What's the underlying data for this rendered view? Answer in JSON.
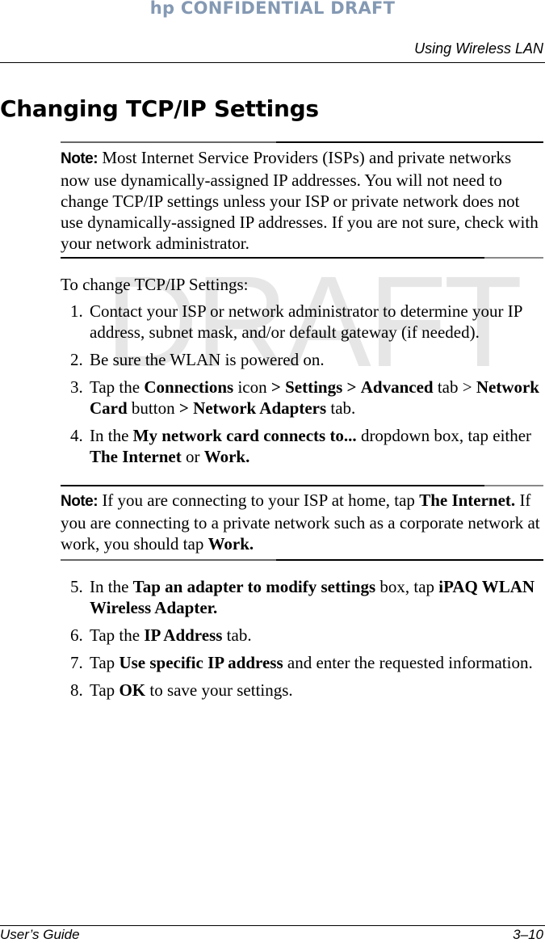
{
  "header": {
    "confidential": "hp CONFIDENTIAL DRAFT",
    "running_title": "Using Wireless LAN"
  },
  "watermark": "DRAFT",
  "section_title": "Changing TCP/IP Settings",
  "note1": {
    "label": "Note:",
    "text": " Most Internet Service Providers (ISPs) and private networks now use dynamically-assigned IP addresses. You will not need to change TCP/IP settings unless your ISP or private network does not use dynamically-assigned IP addresses. If you are not sure, check with your network administrator."
  },
  "intro": "To change TCP/IP Settings:",
  "steps_a": [
    {
      "num": "1.",
      "parts": [
        {
          "t": "Contact your ISP or network administrator to determine your IP address, subnet mask, and/or default gateway (if needed)."
        }
      ]
    },
    {
      "num": "2.",
      "parts": [
        {
          "t": "Be sure the WLAN is powered on."
        }
      ]
    },
    {
      "num": "3.",
      "parts": [
        {
          "t": "Tap the "
        },
        {
          "t": "Connections",
          "b": true
        },
        {
          "t": " icon "
        },
        {
          "t": ">",
          "b": true
        },
        {
          "t": " "
        },
        {
          "t": "Settings",
          "b": true
        },
        {
          "t": " "
        },
        {
          "t": ">",
          "b": true
        },
        {
          "t": " "
        },
        {
          "t": "Advanced",
          "b": true
        },
        {
          "t": " tab > "
        },
        {
          "t": "Network Card",
          "b": true
        },
        {
          "t": " button "
        },
        {
          "t": ">",
          "b": true
        },
        {
          "t": " "
        },
        {
          "t": "Network Adapters",
          "b": true
        },
        {
          "t": " tab."
        }
      ]
    },
    {
      "num": "4.",
      "parts": [
        {
          "t": "In the "
        },
        {
          "t": "My network card connects to...",
          "b": true
        },
        {
          "t": " dropdown box, tap either "
        },
        {
          "t": "The Internet",
          "b": true
        },
        {
          "t": " or "
        },
        {
          "t": "Work.",
          "b": true
        }
      ]
    }
  ],
  "note2": {
    "label": "Note:",
    "parts": [
      {
        "t": " If you are connecting to your ISP at home, tap "
      },
      {
        "t": "The Internet.",
        "b": true
      },
      {
        "t": " If you are connecting to a private network such as a corporate network at work, you should tap "
      },
      {
        "t": "Work.",
        "b": true
      }
    ]
  },
  "steps_b": [
    {
      "num": "5.",
      "parts": [
        {
          "t": "In the "
        },
        {
          "t": "Tap an adapter to modify settings",
          "b": true
        },
        {
          "t": " box, tap "
        },
        {
          "t": "iPAQ WLAN Wireless Adapter.",
          "b": true
        }
      ]
    },
    {
      "num": "6.",
      "parts": [
        {
          "t": "Tap the "
        },
        {
          "t": "IP Address",
          "b": true
        },
        {
          "t": " tab."
        }
      ]
    },
    {
      "num": "7.",
      "parts": [
        {
          "t": "Tap "
        },
        {
          "t": "Use specific IP address",
          "b": true
        },
        {
          "t": " and enter the requested information."
        }
      ]
    },
    {
      "num": "8.",
      "parts": [
        {
          "t": "Tap "
        },
        {
          "t": "OK",
          "b": true
        },
        {
          "t": " to save your settings."
        }
      ]
    }
  ],
  "footer": {
    "left": "User’s Guide",
    "right": "3–10"
  }
}
